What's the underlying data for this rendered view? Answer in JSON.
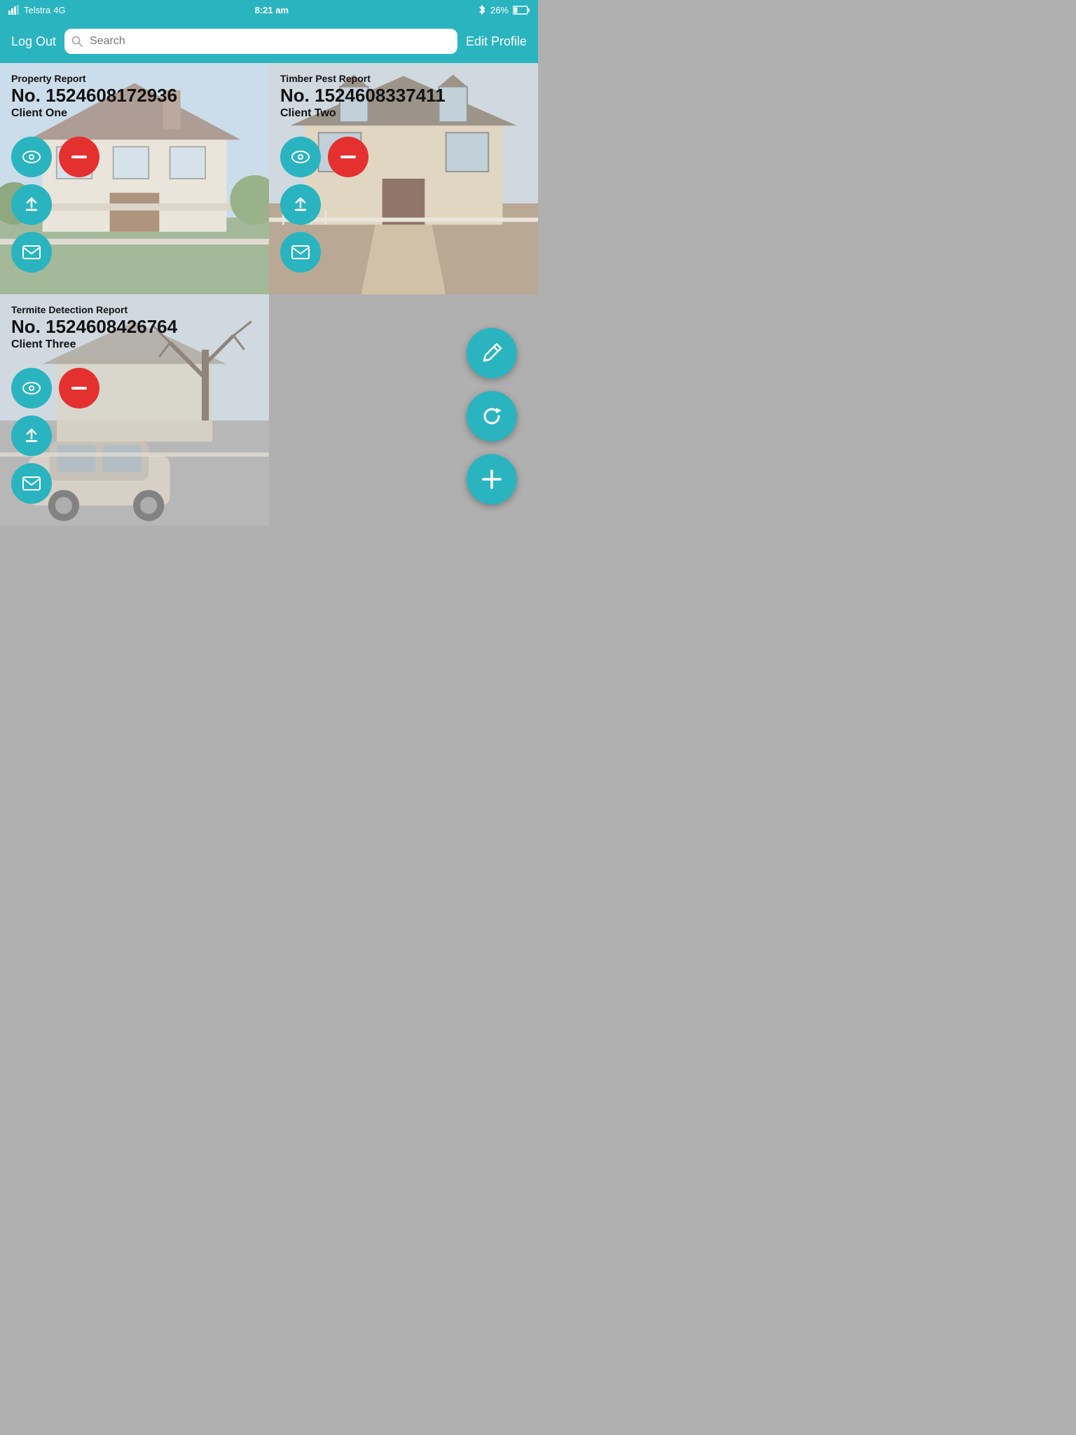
{
  "statusBar": {
    "carrier": "Telstra",
    "network": "4G",
    "time": "8:21 am",
    "bluetooth": "✦",
    "battery": "26%"
  },
  "navBar": {
    "logoutLabel": "Log Out",
    "searchPlaceholder": "Search",
    "editProfileLabel": "Edit Profile"
  },
  "cards": [
    {
      "id": "card-1",
      "reportType": "Property Report",
      "number": "No. 1524608172936",
      "client": "Client One",
      "bgClass": "card-bg-1"
    },
    {
      "id": "card-2",
      "reportType": "Timber Pest Report",
      "number": "No. 1524608337411",
      "client": "Client Two",
      "bgClass": "card-bg-2"
    },
    {
      "id": "card-3",
      "reportType": "Termite Detection Report",
      "number": "No. 1524608426764",
      "client": "Client Three",
      "bgClass": "card-bg-3"
    }
  ],
  "actionButtons": {
    "viewLabel": "view",
    "deleteLabel": "delete",
    "uploadLabel": "upload",
    "emailLabel": "email"
  },
  "fabButtons": {
    "editLabel": "edit",
    "refreshLabel": "refresh",
    "addLabel": "add"
  }
}
